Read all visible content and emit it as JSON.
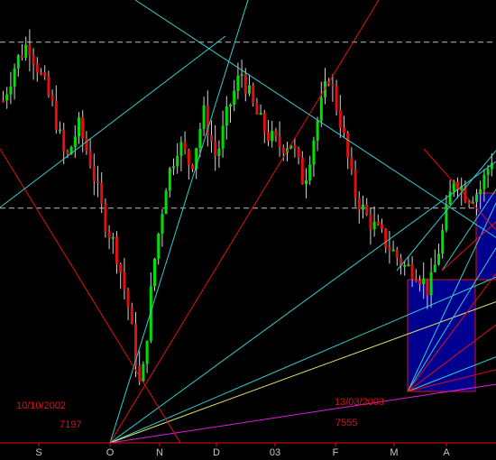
{
  "colors": {
    "background": "#000000",
    "bull_candle": "#00e000",
    "bear_candle": "#e01010",
    "wick": "#d0d0d0",
    "dashed_level": "#bfbfbf",
    "fan_red": "#e01010",
    "fan_cyan": "#33cccc",
    "fan_yellow": "#e8e870",
    "fan_magenta": "#e020e0",
    "box_fill": "#000090",
    "box_border": "#e01010",
    "axis": "#e01010",
    "month_label": "#c8c8c8",
    "annotation": "#e01010"
  },
  "chart_data": {
    "type": "candlestick",
    "title": "",
    "x_axis": {
      "labels": [
        "S",
        "O",
        "N",
        "D",
        "03",
        "F",
        "M",
        "A"
      ]
    },
    "y_range": [
      0,
      100
    ],
    "dashed_levels": [
      92,
      52
    ],
    "price_path": [
      [
        0,
        78
      ],
      [
        1,
        87
      ],
      [
        2,
        92
      ],
      [
        3,
        84
      ],
      [
        4,
        76
      ],
      [
        5,
        63
      ],
      [
        6,
        72
      ],
      [
        7,
        63
      ],
      [
        8,
        50
      ],
      [
        9,
        42
      ],
      [
        10,
        28
      ],
      [
        11,
        7
      ],
      [
        12,
        38
      ],
      [
        13,
        58
      ],
      [
        14,
        68
      ],
      [
        15,
        62
      ],
      [
        16,
        75
      ],
      [
        17,
        64
      ],
      [
        18,
        76
      ],
      [
        19,
        85
      ],
      [
        20,
        76
      ],
      [
        21,
        70
      ],
      [
        22,
        67
      ],
      [
        23,
        68
      ],
      [
        24,
        58
      ],
      [
        25,
        72
      ],
      [
        26,
        84
      ],
      [
        27,
        72
      ],
      [
        28,
        56
      ],
      [
        29,
        50
      ],
      [
        30,
        46
      ],
      [
        31,
        42
      ],
      [
        32,
        38
      ],
      [
        33,
        37
      ],
      [
        34,
        32
      ],
      [
        35,
        45
      ],
      [
        36,
        60
      ],
      [
        37,
        55
      ],
      [
        38,
        56
      ],
      [
        39,
        64
      ]
    ],
    "annotations": [
      {
        "date": "10/10/2002",
        "value": "7197"
      },
      {
        "date": "13/03/2003",
        "value": "7555"
      }
    ],
    "gann_fans": [
      {
        "origin": "10/10/2002",
        "colors": [
          "red",
          "cyan",
          "yellow",
          "magenta"
        ]
      },
      {
        "origin": "13/03/2003",
        "colors": [
          "red",
          "cyan"
        ]
      }
    ]
  }
}
